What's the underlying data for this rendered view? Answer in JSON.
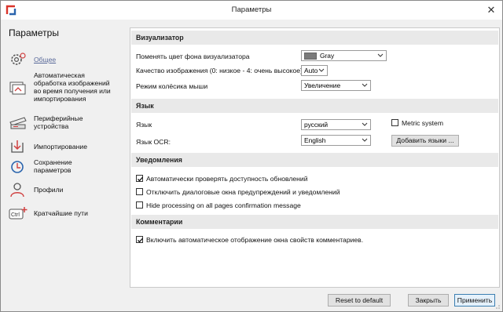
{
  "window": {
    "title": "Параметры"
  },
  "sidebar": {
    "title": "Параметры",
    "items": [
      {
        "label": "Общее",
        "icon": "gear-icon",
        "active": true
      },
      {
        "label": "Автоматическая обработка изображений во время получения или импортирования",
        "icon": "auto-process-icon"
      },
      {
        "label": "Периферийные устройства",
        "icon": "scanner-icon"
      },
      {
        "label": "Импортирование",
        "icon": "import-icon"
      },
      {
        "label": "Сохранение параметров",
        "icon": "save-settings-icon"
      },
      {
        "label": "Профили",
        "icon": "profile-icon"
      },
      {
        "label": "Кратчайшие пути",
        "icon": "shortcut-icon"
      }
    ]
  },
  "sections": {
    "visualizer": {
      "header": "Визуализатор",
      "bg_color_label": "Поменять цвет фона визуализатора",
      "bg_color_value": "Gray",
      "quality_label": "Качество изображения (0: низкое - 4: очень высокое)",
      "quality_value": "Auto",
      "wheel_label": "Режим колёсика мыши",
      "wheel_value": "Увеличение"
    },
    "language": {
      "header": "Язык",
      "lang_label": "Язык",
      "lang_value": "русский",
      "metric_label": "Metric system",
      "metric_checked": false,
      "ocr_label": "Язык OCR:",
      "ocr_value": "English",
      "add_lang_button": "Добавить языки ..."
    },
    "notifications": {
      "header": "Уведомления",
      "items": [
        {
          "label": "Автоматически проверять доступность обновлений",
          "checked": true
        },
        {
          "label": "Отключить диалоговые окна предупреждений и уведомлений",
          "checked": false
        },
        {
          "label": "Hide processing on all pages confirmation message",
          "checked": false
        }
      ]
    },
    "comments": {
      "header": "Комментарии",
      "items": [
        {
          "label": "Включить автоматическое отображение окна свойств комментариев.",
          "checked": true
        }
      ]
    }
  },
  "footer": {
    "reset": "Reset to default",
    "close": "Закрыть",
    "apply": "Применить"
  },
  "colors": {
    "gray_swatch": "#7b7b7b",
    "accent": "#3c7fb1",
    "active_nav": "#5a6a9a"
  }
}
